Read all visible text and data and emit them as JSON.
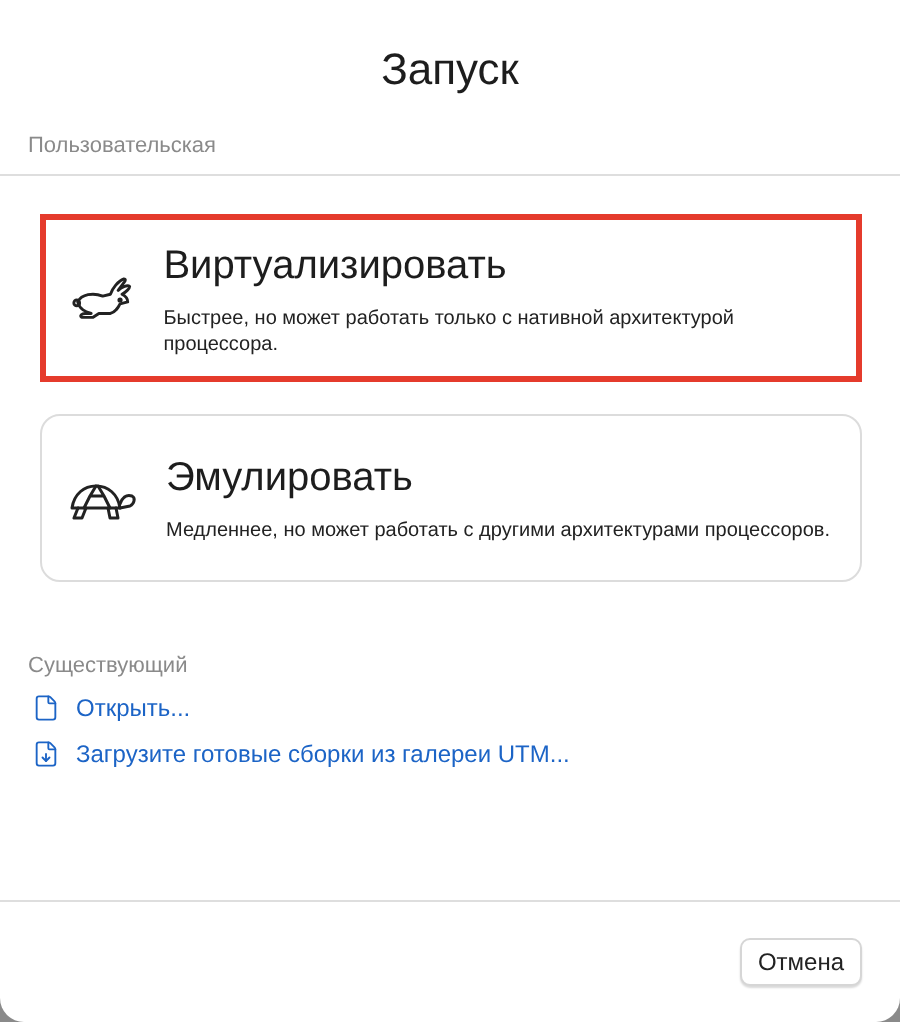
{
  "window": {
    "title": "Запуск"
  },
  "custom": {
    "heading": "Пользовательская",
    "options": [
      {
        "kind": "virtualize",
        "title": "Виртуализировать",
        "description": "Быстрее, но может работать только с нативной архитектурой процессора.",
        "highlighted": true
      },
      {
        "kind": "emulate",
        "title": "Эмулировать",
        "description": "Медленнее, но может работать с другими архитектурами процессоров.",
        "highlighted": false
      }
    ]
  },
  "existing": {
    "heading": "Существующий",
    "links": [
      {
        "kind": "open",
        "label": "Открыть..."
      },
      {
        "kind": "download",
        "label": "Загрузите готовые сборки из галереи UTM..."
      }
    ]
  },
  "buttons": [
    "Отмена"
  ]
}
